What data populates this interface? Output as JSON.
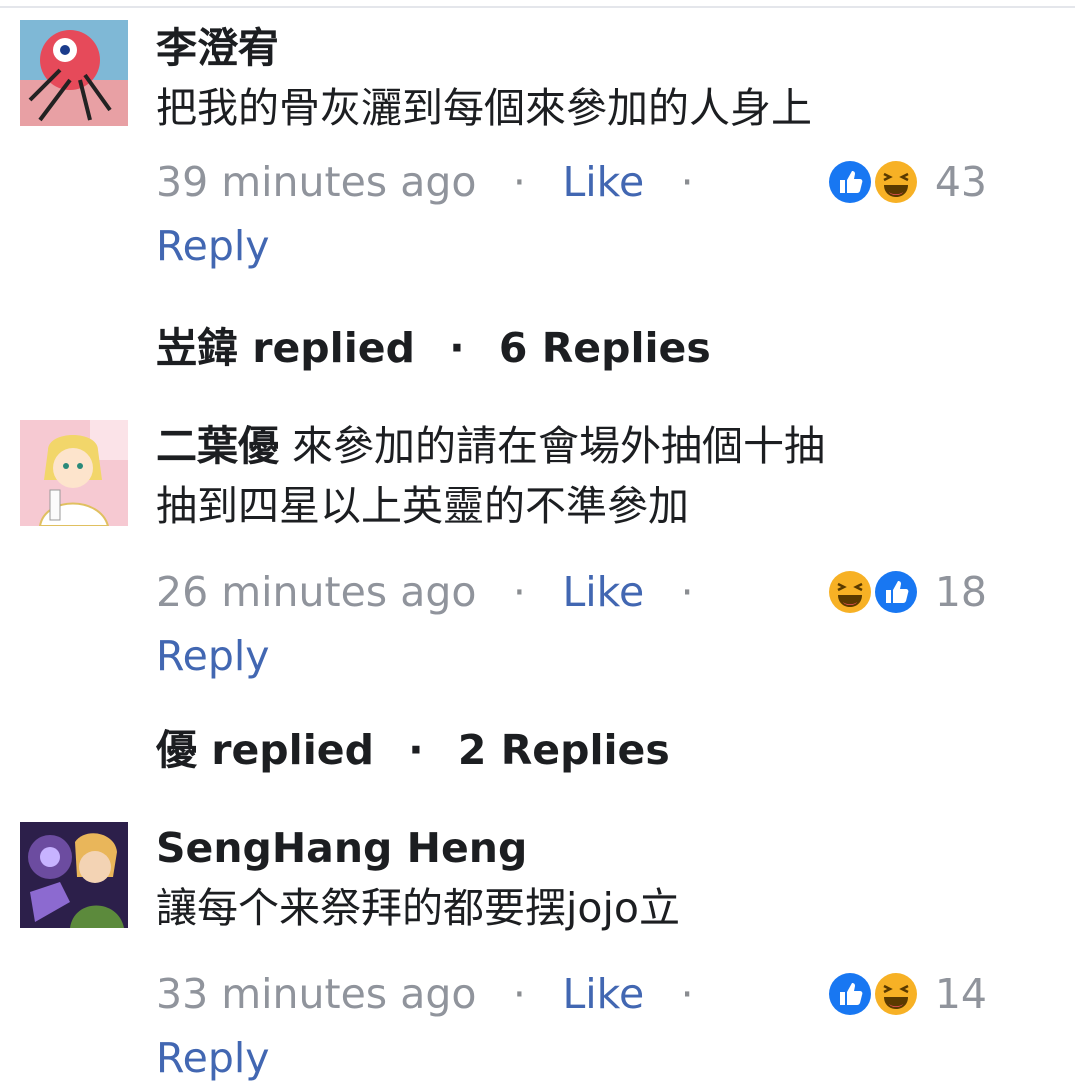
{
  "comments": [
    {
      "author": "李澄宥",
      "lines": [
        "把我的骨灰灑到每個來參加的人身上"
      ],
      "time": "39 minutes ago",
      "like_label": "Like",
      "reply_label": "Reply",
      "reactions": [
        "like",
        "haha"
      ],
      "reaction_count": "43",
      "replies_summary": {
        "who": "岦鍏 replied",
        "count": "6 Replies"
      }
    },
    {
      "author": "二葉優",
      "lines": [
        "來參加的請在會場外抽個十抽",
        "抽到四星以上英靈的不準參加"
      ],
      "time": "26 minutes ago",
      "like_label": "Like",
      "reply_label": "Reply",
      "reactions": [
        "haha",
        "like"
      ],
      "reaction_count": "18",
      "replies_summary": {
        "who": "優 replied",
        "count": "2 Replies"
      }
    },
    {
      "author": "SengHang Heng",
      "lines": [
        "讓每个来祭拜的都要摆jojo立"
      ],
      "time": "33 minutes ago",
      "like_label": "Like",
      "reply_label": "Reply",
      "reactions": [
        "like",
        "haha"
      ],
      "reaction_count": "14"
    }
  ],
  "separator": "·",
  "colors": {
    "link": "#4267b2",
    "meta": "#90949c",
    "text": "#1c1e21",
    "like_blue": "#1877f2",
    "haha_yellow": "#f7b125"
  }
}
